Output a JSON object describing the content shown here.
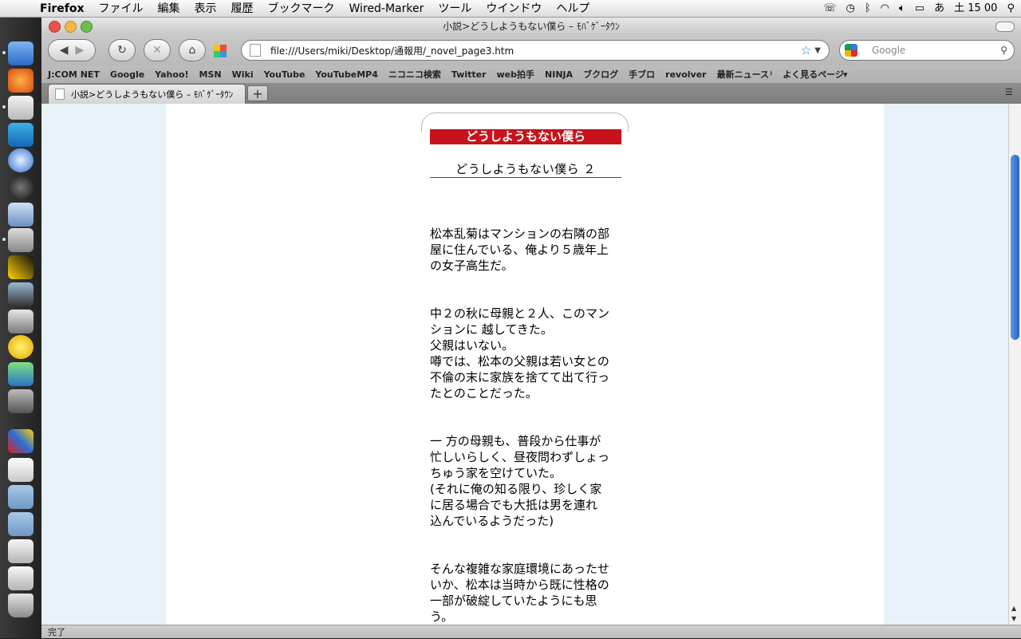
{
  "menubar": {
    "apple": "",
    "items": [
      "Firefox",
      "ファイル",
      "編集",
      "表示",
      "履歴",
      "ブックマーク",
      "Wired-Marker",
      "ツール",
      "ウインドウ",
      "ヘルプ"
    ],
    "clock": "土 15 00",
    "input_method": "あ"
  },
  "window": {
    "title": "小説>どうしようもない僕ら – ﾓﾊﾞｹﾞｰﾀｳﾝ",
    "url": "file:///Users/miki/Desktop/通報用/_novel_page3.htm",
    "search_placeholder": "Google"
  },
  "bookmarks": [
    "J:COM NET",
    "Google",
    "Yahoo!",
    "MSN",
    "Wiki",
    "YouTube",
    "YouTubeMP4",
    "ニコニコ検索",
    "Twitter",
    "web拍手",
    "NINJA",
    "ブクログ",
    "手ブロ",
    "revolver",
    "最新ニュース",
    "よく見るページ"
  ],
  "tab": {
    "title": "小説>どうしようもない僕ら – ﾓﾊﾞｹﾞｰﾀｳﾝ",
    "new_tab": "+"
  },
  "novel": {
    "title": "どうしようもない僕ら",
    "chapter": "どうしようもない僕ら ２",
    "paragraphs": [
      [
        "松本乱菊はマンションの右隣の部",
        "屋に住んでいる、俺より５歳年上",
        "の女子高生だ。"
      ],
      [
        "中２の秋に母親と２人、このマン",
        "ションに 越してきた。",
        "父親はいない。",
        "噂では、松本の父親は若い女との",
        "不倫の末に家族を捨てて出て行っ",
        "たとのことだった。"
      ],
      [
        "一 方の母親も、普段から仕事が",
        "忙しいらしく、昼夜問わずしょっ",
        "ちゅう家を空けていた。",
        "(それに俺の知る限り、珍しく家",
        "に居る場合でも大抵は男を連れ",
        "込んでいるようだった)"
      ],
      [
        "そんな複雑な家庭環境にあったせ",
        "いか、松本は当時から既に性格の",
        "一部が破綻していたようにも思",
        "う。"
      ]
    ]
  },
  "status": "完了"
}
